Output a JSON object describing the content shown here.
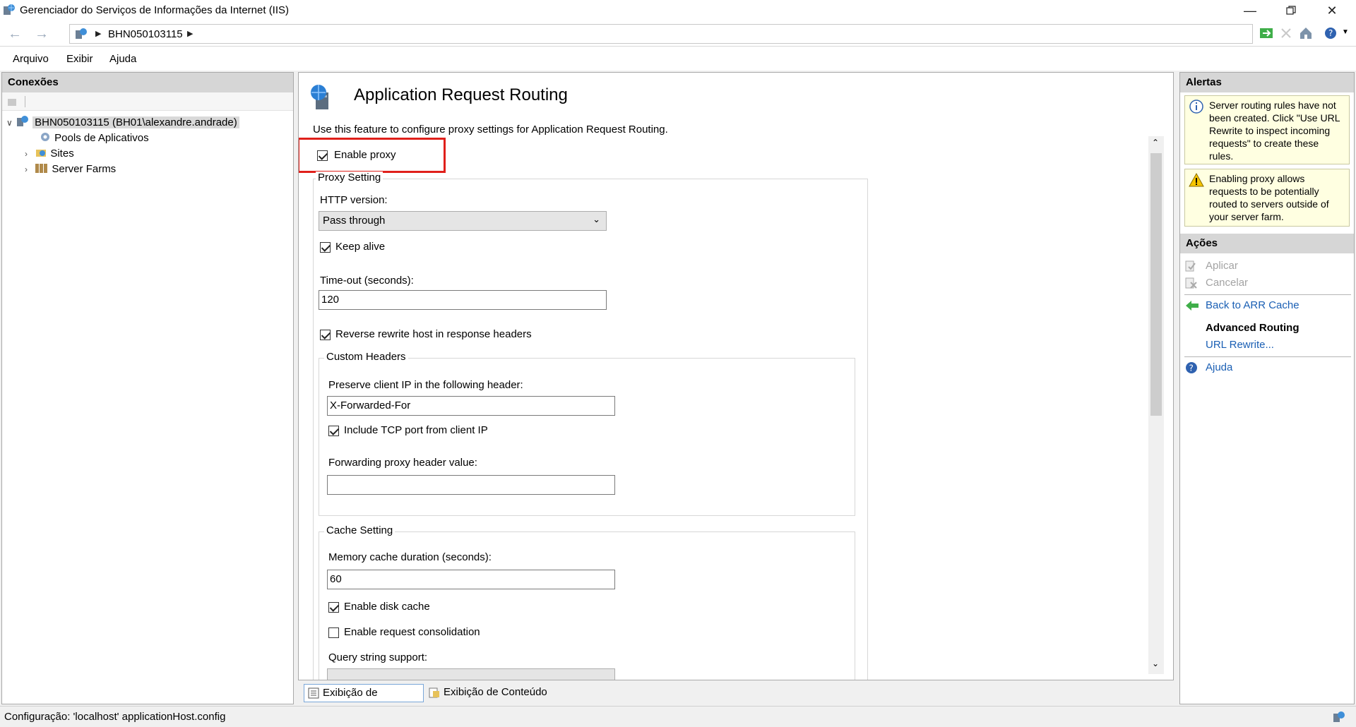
{
  "window": {
    "title": "Gerenciador do Serviços de Informações da Internet (IIS)"
  },
  "address": {
    "breadcrumb": "BHN050103115"
  },
  "menu": [
    "Arquivo",
    "Exibir",
    "Ajuda"
  ],
  "connections": {
    "header": "Conexões",
    "root": "BHN050103115 (BH01\\alexandre.andrade)",
    "items": [
      "Pools de Aplicativos",
      "Sites",
      "Server Farms"
    ]
  },
  "feature": {
    "title": "Application Request Routing",
    "description": "Use this feature to configure proxy settings for Application Request Routing.",
    "enable_proxy": {
      "label": "Enable proxy",
      "checked": true
    },
    "proxy_setting": {
      "title": "Proxy Setting",
      "http_version_label": "HTTP version:",
      "http_version_value": "Pass through",
      "keep_alive": {
        "label": "Keep alive",
        "checked": true
      },
      "timeout_label": "Time-out (seconds):",
      "timeout_value": "120",
      "reverse_rewrite": {
        "label": "Reverse rewrite host in response headers",
        "checked": true
      }
    },
    "custom_headers": {
      "title": "Custom Headers",
      "preserve_ip_label": "Preserve client IP in the following header:",
      "preserve_ip_value": "X-Forwarded-For",
      "include_tcp": {
        "label": "Include TCP port from client IP",
        "checked": true
      },
      "forwarding_label": "Forwarding proxy header value:",
      "forwarding_value": ""
    },
    "cache_setting": {
      "title": "Cache Setting",
      "memory_label": "Memory cache duration (seconds):",
      "memory_value": "60",
      "disk_cache": {
        "label": "Enable disk cache",
        "checked": true
      },
      "request_consolidation": {
        "label": "Enable request consolidation",
        "checked": false
      },
      "query_string_label": "Query string support:"
    }
  },
  "alerts": {
    "header": "Alertas",
    "items": [
      "Server routing rules have not been created. Click \"Use URL Rewrite to inspect incoming requests\" to create these rules.",
      "Enabling proxy allows requests to be potentially routed to servers outside of your server farm."
    ]
  },
  "actions": {
    "header": "Ações",
    "apply": "Aplicar",
    "cancel": "Cancelar",
    "back": "Back to ARR Cache",
    "advanced_title": "Advanced Routing",
    "url_rewrite": "URL Rewrite...",
    "help": "Ajuda"
  },
  "tabs": [
    "Exibição de Recursos",
    "Exibição de Conteúdo"
  ],
  "status": {
    "text": "Configuração: 'localhost' applicationHost.config"
  },
  "colors": {
    "highlight_box": "#e0201b",
    "link": "#1a5fb4",
    "alert_bg": "#ffffe1"
  }
}
